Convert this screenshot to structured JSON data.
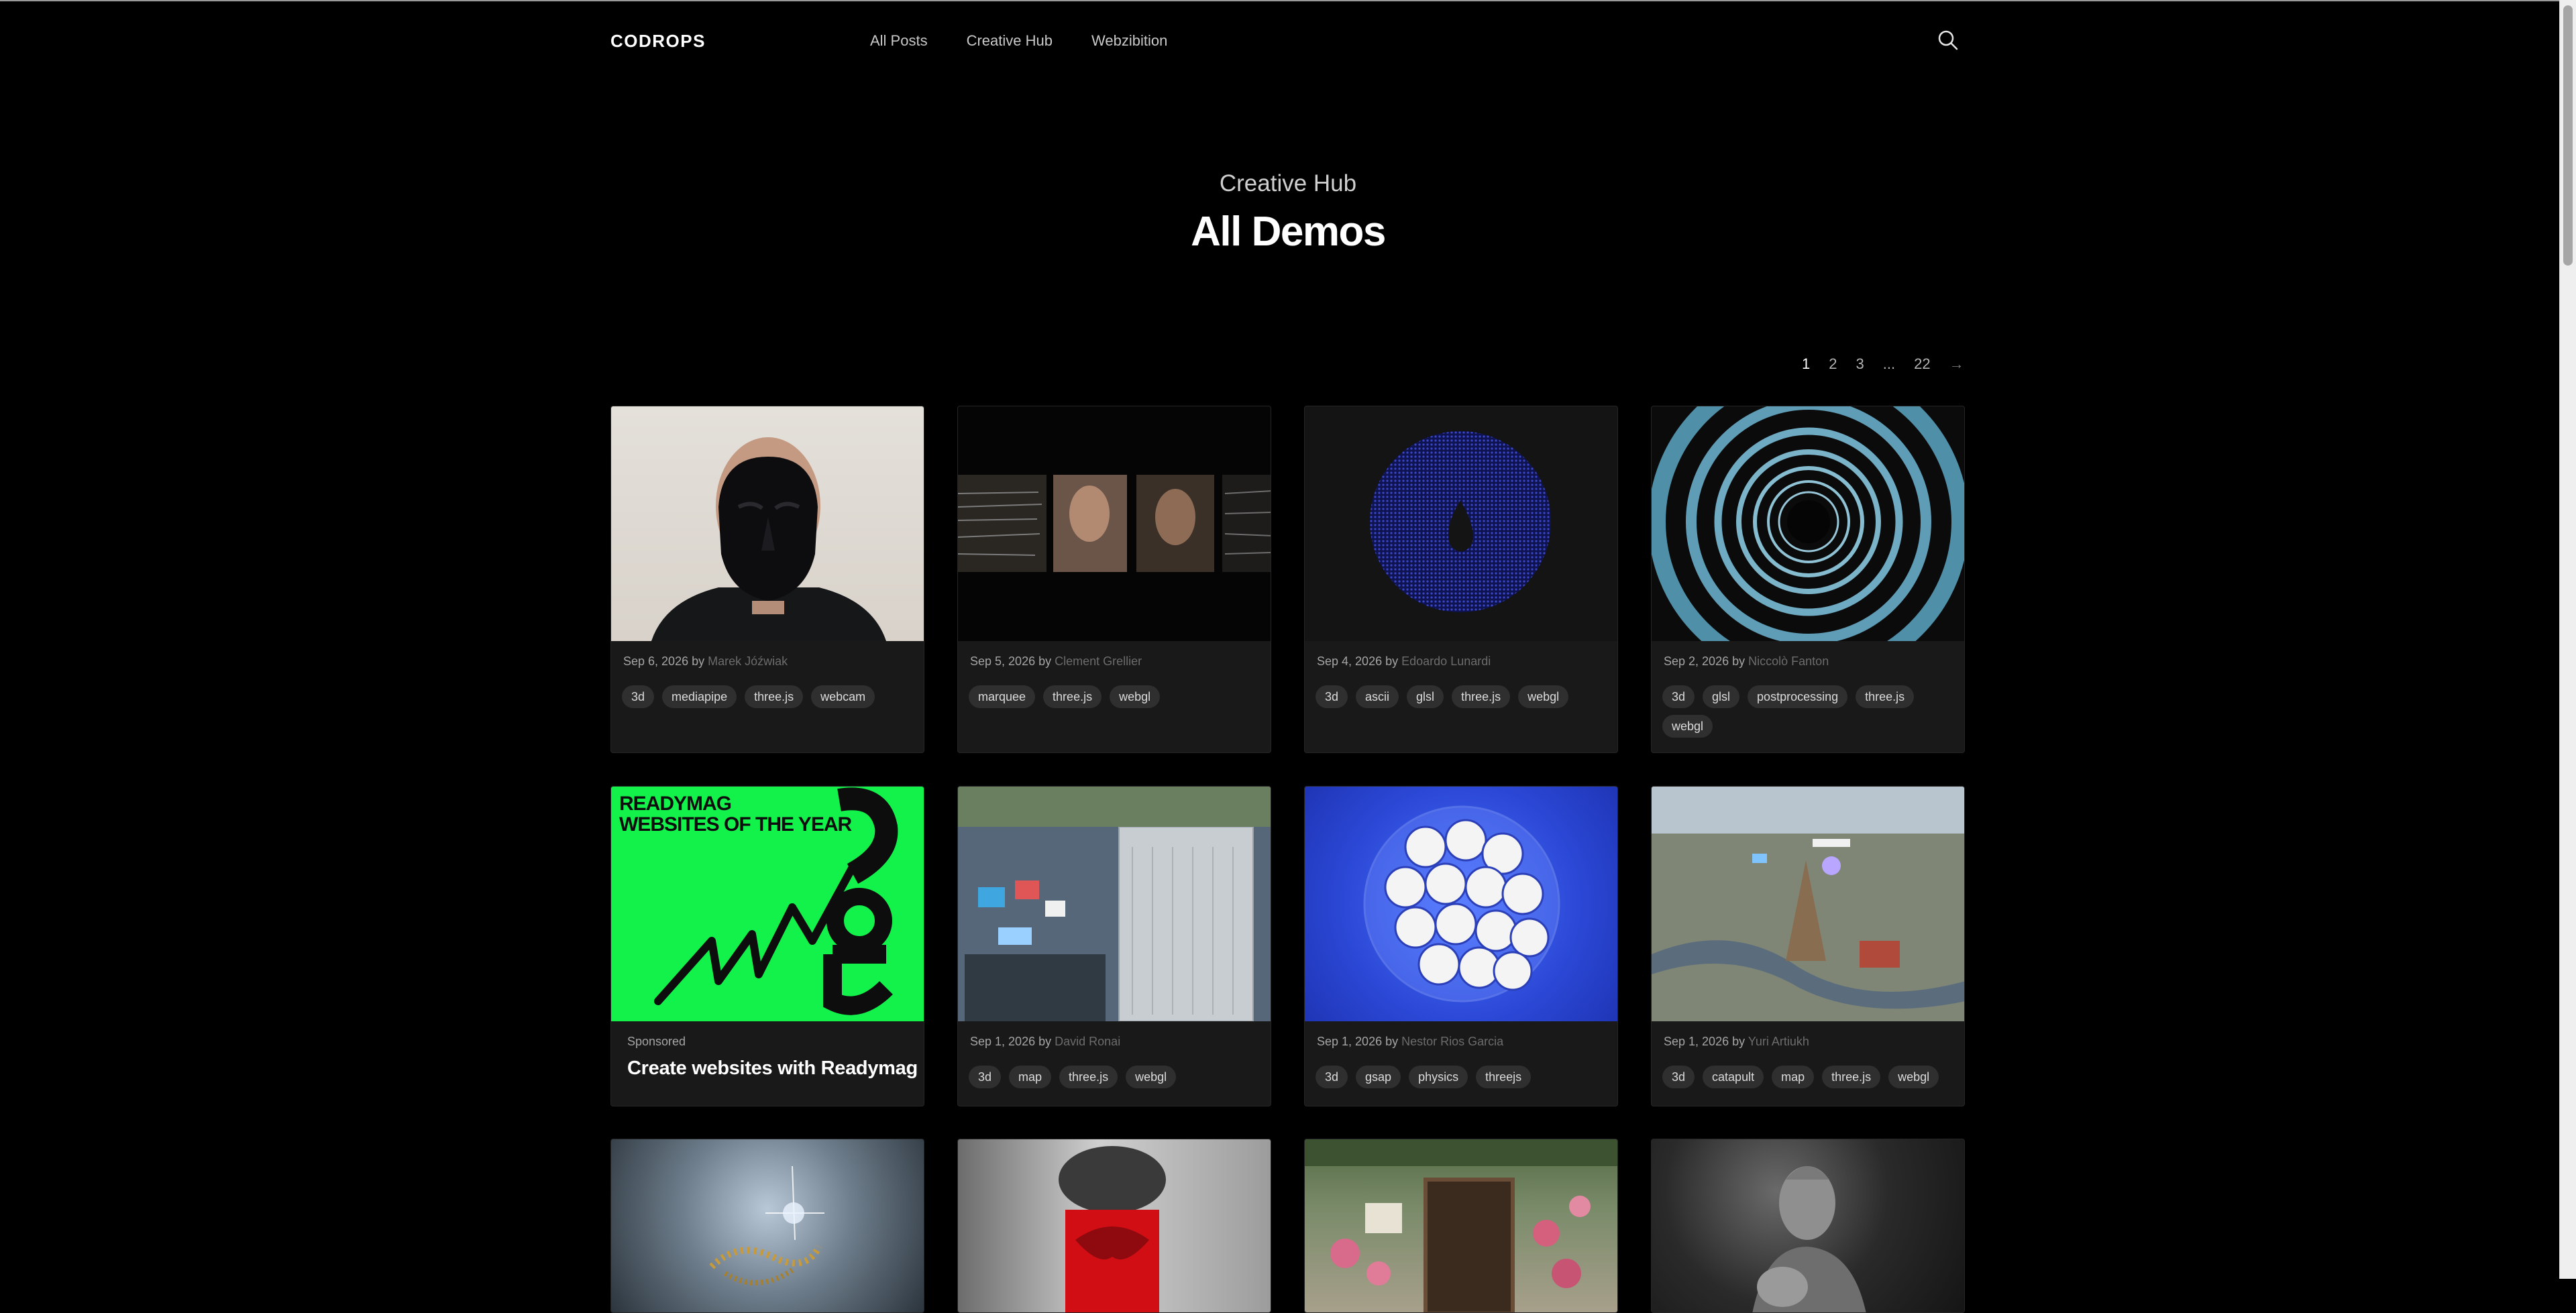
{
  "header": {
    "logo": "CODROPS",
    "nav": [
      "All Posts",
      "Creative Hub",
      "Webzibition"
    ]
  },
  "hero": {
    "eyebrow": "Creative Hub",
    "title": "All Demos"
  },
  "pagination": {
    "pages": [
      "1",
      "2",
      "3",
      "...",
      "22"
    ],
    "current": "1",
    "next": "→"
  },
  "cards": [
    {
      "date": "Sep 6, 2026",
      "by": "by",
      "author": "Marek Jóźwiak",
      "tags": [
        "3d",
        "mediapipe",
        "three.js",
        "webcam"
      ]
    },
    {
      "date": "Sep 5, 2026",
      "by": "by",
      "author": "Clement Grellier",
      "tags": [
        "marquee",
        "three.js",
        "webgl"
      ]
    },
    {
      "date": "Sep 4, 2026",
      "by": "by",
      "author": "Edoardo Lunardi",
      "tags": [
        "3d",
        "ascii",
        "glsl",
        "three.js",
        "webgl"
      ]
    },
    {
      "date": "Sep 2, 2026",
      "by": "by",
      "author": "Niccolò Fanton",
      "tags": [
        "3d",
        "glsl",
        "postprocessing",
        "three.js",
        "webgl"
      ]
    },
    {
      "sponsored": true,
      "label": "Sponsored",
      "title": "Create websites with Readymag",
      "image_text": [
        "READYMAG",
        "WEBSITES OF THE YEAR"
      ]
    },
    {
      "date": "Sep 1, 2026",
      "by": "by",
      "author": "David Ronai",
      "tags": [
        "3d",
        "map",
        "three.js",
        "webgl"
      ]
    },
    {
      "date": "Sep 1, 2026",
      "by": "by",
      "author": "Nestor Rios Garcia",
      "tags": [
        "3d",
        "gsap",
        "physics",
        "threejs"
      ]
    },
    {
      "date": "Sep 1, 2026",
      "by": "by",
      "author": "Yuri Artiukh",
      "tags": [
        "3d",
        "catapult",
        "map",
        "three.js",
        "webgl"
      ]
    }
  ],
  "colors": {
    "background": "#000000",
    "card": "#191919",
    "tag": "#2f2f2f",
    "sponsor_green": "#12f24a"
  }
}
